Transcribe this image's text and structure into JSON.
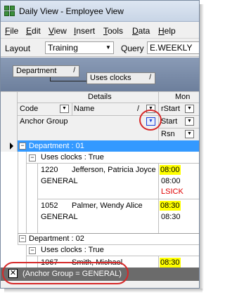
{
  "window": {
    "title": "Daily View  -  Employee View"
  },
  "menu": {
    "items": [
      {
        "first": "F",
        "rest": "ile"
      },
      {
        "first": "E",
        "rest": "dit"
      },
      {
        "first": "V",
        "rest": "iew"
      },
      {
        "first": "I",
        "rest": "nsert"
      },
      {
        "first": "T",
        "rest": "ools"
      },
      {
        "first": "D",
        "rest": "ata"
      },
      {
        "first": "H",
        "rest": "elp"
      }
    ]
  },
  "toolbar": {
    "layout_label": "Layout",
    "layout_value": "Training",
    "query_label": "Query",
    "query_value": "E.WEEKLY"
  },
  "group_by": {
    "chips": [
      {
        "label": "Department"
      },
      {
        "label": "Uses clocks"
      }
    ]
  },
  "columns": {
    "band_details": "Details",
    "band_day": "Mon",
    "code": "Code",
    "name": "Name",
    "anchor_group": "Anchor Group",
    "rstart": "rStart",
    "start": "Start",
    "rsn": "Rsn"
  },
  "groups": [
    {
      "label": "Department : 01",
      "sub_label": "Uses clocks : True",
      "rows": [
        {
          "code": "1220",
          "name": "Jefferson, Patricia Joyce",
          "anchor": "GENERAL",
          "rstart": "08:00",
          "start": "08:00",
          "rsn": "LSICK"
        },
        {
          "code": "1052",
          "name": "Palmer, Wendy Alice",
          "anchor": "GENERAL",
          "rstart": "08:30",
          "start": "08:30"
        }
      ]
    },
    {
      "label": "Department : 02",
      "sub_label": "Uses clocks : True",
      "rows": [
        {
          "code": "1067",
          "name": "Smith, Michael",
          "rstart": "08:30"
        }
      ]
    }
  ],
  "filter": {
    "text": "(Anchor Group = GENERAL)"
  },
  "colors": {
    "selection": "#3399ff",
    "highlight": "#ffff00",
    "callout": "#d62828"
  }
}
